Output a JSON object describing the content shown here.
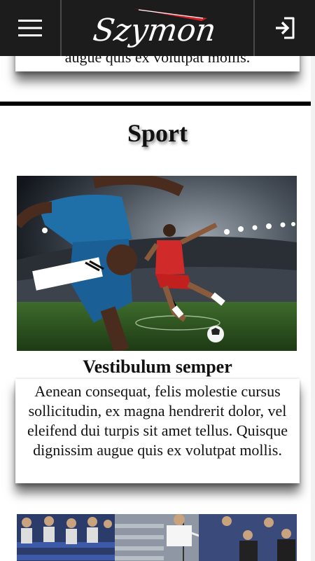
{
  "header": {
    "logo_text": "Szymon",
    "menu_icon": "hamburger-menu-icon",
    "login_icon": "sign-in-icon"
  },
  "previous_article": {
    "text_tail": "augue quis ex volutpat mollis."
  },
  "section": {
    "title": "Sport"
  },
  "article": {
    "image": "soccer-players-stadium",
    "title": "Vestibulum semper",
    "body": "Aenean consequat, felis molestie cursus sollicitudin, ex magna hendrerit dolor, vel eleifend dui turpis sit amet tellus. Quisque dignissim augue quis ex volutpat mollis."
  },
  "next_article": {
    "image": "volleyball-match-crowd"
  },
  "colors": {
    "header_bg": "#1c1c1c",
    "logo_accent": "#d4202a",
    "rule": "#000000"
  }
}
